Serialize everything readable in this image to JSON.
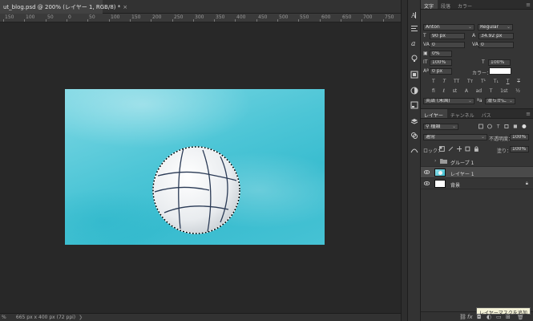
{
  "document": {
    "tab_title": "ut_blog.psd @ 200% (レイヤー 1, RGB/8) *",
    "close_glyph": "×"
  },
  "ruler": {
    "ticks": [
      "150",
      "100",
      "50",
      "0",
      "50",
      "100",
      "150",
      "200",
      "250",
      "300",
      "350",
      "400",
      "450",
      "500",
      "550",
      "600",
      "650",
      "700",
      "750"
    ]
  },
  "status_bar": {
    "zoom": "%",
    "doc_info": "665 px x 400 px (72 ppi)",
    "arrow": "❯"
  },
  "character_panel": {
    "tabs": [
      "文字",
      "段落",
      "カラー"
    ],
    "font_family": "Anton",
    "font_style": "Regular",
    "font_size": "90 px",
    "leading": "34.92 px",
    "kerning": "0",
    "tracking": "0",
    "tsume": "0%",
    "vertical_scale": "100%",
    "horizontal_scale": "100%",
    "baseline_shift": "0 px",
    "color_label": "カラー：",
    "color_swatch": "#ffffff",
    "language": "英語 (米国)",
    "anti_alias": "滑らかに",
    "style_buttons": [
      "T",
      "T",
      "TT",
      "Tт",
      "T¹",
      "T₁",
      "T",
      "T"
    ],
    "style_buttons2": [
      "fi",
      "ℓ",
      "st",
      "A",
      "ad",
      "T",
      "1st",
      "½"
    ]
  },
  "layers_panel": {
    "tabs": [
      "レイヤー",
      "チャンネル",
      "パス"
    ],
    "filter_label": "種類",
    "blend_mode": "通常",
    "opacity_label": "不透明度：",
    "opacity_value": "100%",
    "lock_label": "ロック：",
    "fill_label": "塗り：",
    "fill_value": "100%",
    "layers": [
      {
        "name": "グループ 1",
        "type": "group",
        "visible": false,
        "selected": false
      },
      {
        "name": "レイヤー 1",
        "type": "image",
        "visible": true,
        "selected": true
      },
      {
        "name": "背景",
        "type": "background",
        "visible": true,
        "selected": false
      }
    ],
    "footer_icons": [
      "link-icon",
      "fx-icon",
      "add-mask-icon",
      "adjustment-icon",
      "folder-icon",
      "new-layer-icon",
      "trash-icon"
    ]
  },
  "tooltip": {
    "text": "レイヤーマスクを追加"
  }
}
